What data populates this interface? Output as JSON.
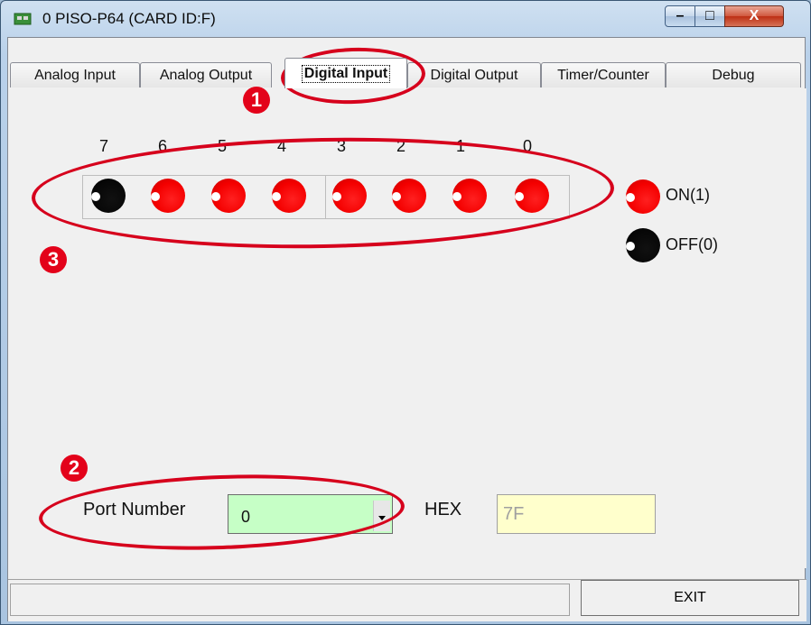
{
  "window": {
    "title": "0 PISO-P64 (CARD ID:F)",
    "icon": "card-app-icon",
    "controls": {
      "minimize": "–",
      "maximize": "□",
      "close": "X"
    }
  },
  "tabs": [
    {
      "label": "Analog Input",
      "active": false
    },
    {
      "label": "Analog Output",
      "active": false
    },
    {
      "label": "Digital Input",
      "active": true
    },
    {
      "label": "Digital Output",
      "active": false
    },
    {
      "label": "Timer/Counter",
      "active": false
    },
    {
      "label": "Debug",
      "active": false
    }
  ],
  "bits": {
    "labels": [
      "7",
      "6",
      "5",
      "4",
      "3",
      "2",
      "1",
      "0"
    ],
    "states": [
      "off",
      "on",
      "on",
      "on",
      "on",
      "on",
      "on",
      "on"
    ]
  },
  "legend": {
    "on": "ON(1)",
    "off": "OFF(0)"
  },
  "port": {
    "label": "Port Number",
    "value": "0"
  },
  "hex": {
    "label": "HEX",
    "value": "7F"
  },
  "exit_button": "EXIT",
  "annotations": [
    "1",
    "2",
    "3"
  ],
  "colors": {
    "led_on": "#f40000",
    "led_off": "#000000",
    "annotation": "#d6001c",
    "port_bg": "#c6ffc6",
    "hex_bg": "#ffffcc"
  }
}
